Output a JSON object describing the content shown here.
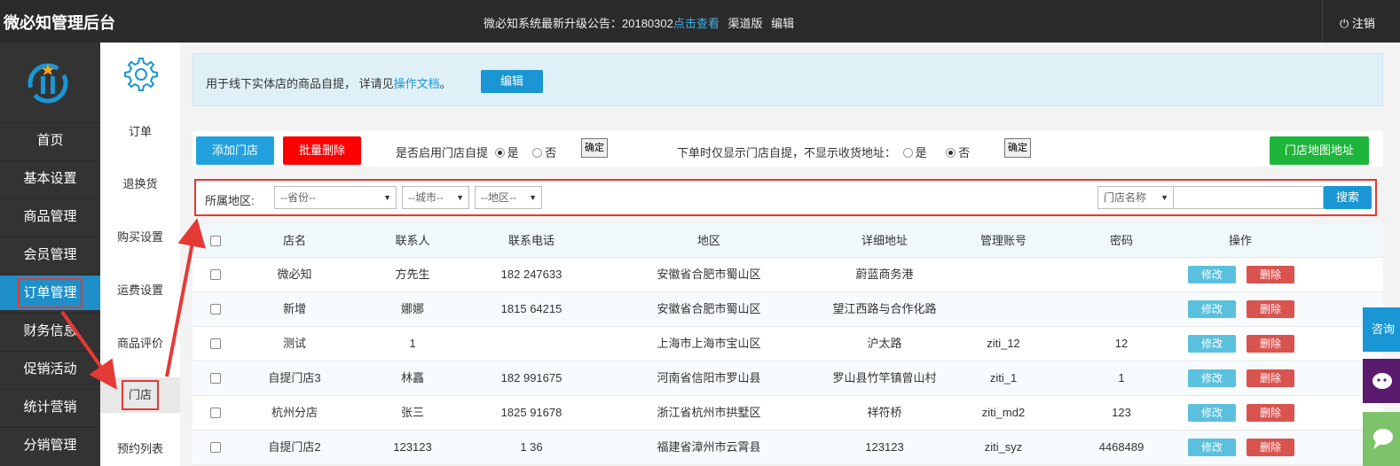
{
  "header": {
    "brand": "微必知管理后台",
    "notice_prefix": "微必知系统最新升级公告：20180302",
    "notice_link": "点击查看",
    "channel": "渠道版",
    "edit": "编辑",
    "logout": "注销"
  },
  "sidebar": {
    "items": [
      {
        "label": "首页"
      },
      {
        "label": "基本设置"
      },
      {
        "label": "商品管理"
      },
      {
        "label": "会员管理"
      },
      {
        "label": "订单管理"
      },
      {
        "label": "财务信息"
      },
      {
        "label": "促销活动"
      },
      {
        "label": "统计营销"
      },
      {
        "label": "分销管理"
      }
    ]
  },
  "subnav": {
    "items": [
      {
        "label": "订单"
      },
      {
        "label": "退换货"
      },
      {
        "label": "购买设置"
      },
      {
        "label": "运费设置"
      },
      {
        "label": "商品评价"
      },
      {
        "label": "门店"
      },
      {
        "label": "预约列表"
      }
    ]
  },
  "info": {
    "text": "用于线下实体店的商品自提， 详请见",
    "link": "操作文档",
    "tail": "。",
    "edit_button": "编辑"
  },
  "toolbar": {
    "add": "添加门店",
    "batch_delete": "批量删除",
    "enable_label": "是否启用门店自提",
    "yes": "是",
    "no": "否",
    "confirm": "确定",
    "only_label": "下单时仅显示门店自提，不显示收货地址：",
    "map": "门店地图地址"
  },
  "filter": {
    "label": "所属地区:",
    "province": "--省份--",
    "city": "--城市--",
    "district": "--地区--",
    "search_type": "门店名称",
    "search_button": "搜索"
  },
  "table": {
    "headers": [
      "店名",
      "联系人",
      "联系电话",
      "地区",
      "详细地址",
      "管理账号",
      "密码",
      "操作"
    ],
    "rows": [
      {
        "name": "微必知",
        "contact": "方先生",
        "phone": "182 247633",
        "region": "安徽省合肥市蜀山区",
        "address": "蔚蓝商务港",
        "account": "",
        "password": ""
      },
      {
        "name": "新增",
        "contact": "娜娜",
        "phone": "1815 64215",
        "region": "安徽省合肥市蜀山区",
        "address": "望江西路与合作化路",
        "account": "",
        "password": ""
      },
      {
        "name": "测试",
        "contact": "1",
        "phone": "",
        "region": "上海市上海市宝山区",
        "address": "沪太路",
        "account": "ziti_12",
        "password": "12"
      },
      {
        "name": "自提门店3",
        "contact": "林靐",
        "phone": "182 991675",
        "region": "河南省信阳市罗山县",
        "address": "罗山县竹竿镇曾山村",
        "account": "ziti_1",
        "password": "1"
      },
      {
        "name": "杭州分店",
        "contact": "张三",
        "phone": "1825 91678",
        "region": "浙江省杭州市拱墅区",
        "address": "祥符桥",
        "account": "ziti_md2",
        "password": "123"
      },
      {
        "name": "自提门店2",
        "contact": "123123",
        "phone": "1 36",
        "region": "福建省漳州市云霄县",
        "address": "123123",
        "account": "ziti_syz",
        "password": "4468489"
      }
    ],
    "modify": "修改",
    "delete": "删除"
  },
  "float": {
    "consult": "咨询"
  }
}
